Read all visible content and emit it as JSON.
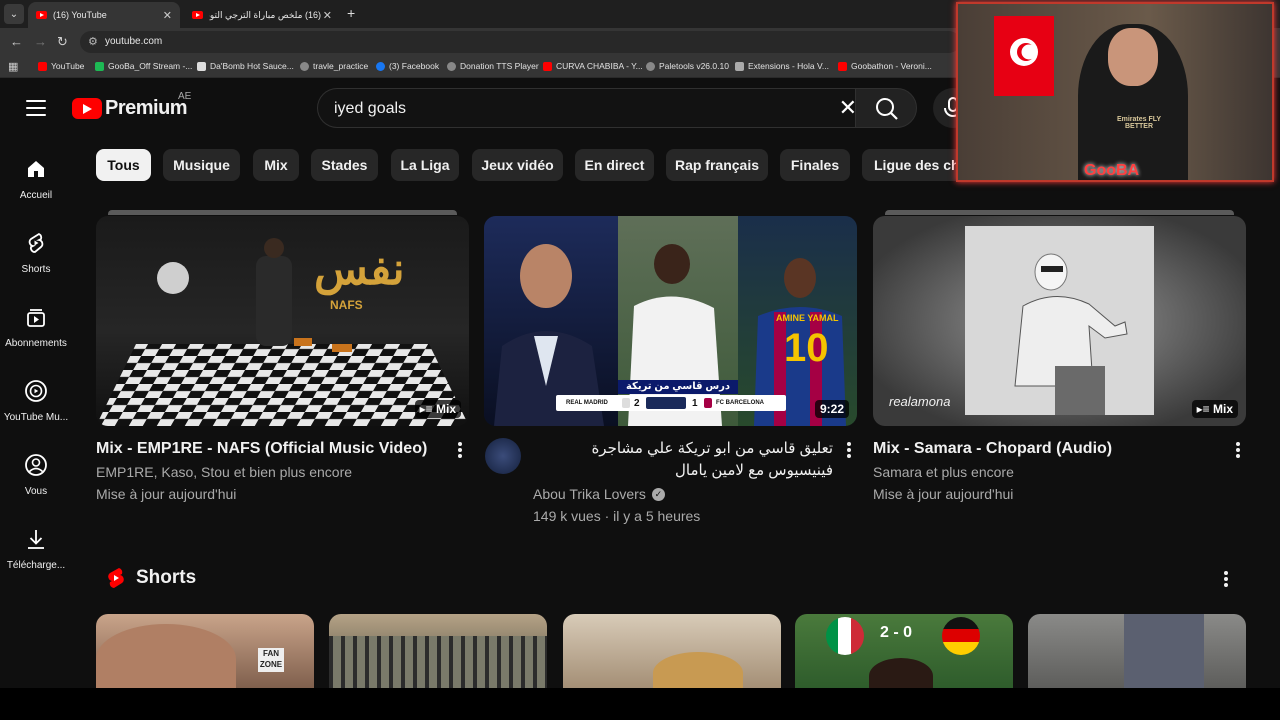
{
  "browser": {
    "tabs": [
      {
        "title": "(16) YouTube"
      },
      {
        "title": "(16) ملخص مباراة الترجي التونس..."
      }
    ],
    "url": "youtube.com",
    "bookmarks": [
      {
        "label": "YouTube",
        "color": "#ff0000"
      },
      {
        "label": "GooBa_Off Stream -...",
        "color": "#1db954"
      },
      {
        "label": "Da'Bomb Hot Sauce...",
        "color": "#dddddd"
      },
      {
        "label": "travle_practice",
        "color": "#888888"
      },
      {
        "label": "(3) Facebook",
        "color": "#1877f2"
      },
      {
        "label": "Donation TTS Player",
        "color": "#888888"
      },
      {
        "label": "CURVA CHABIBA - Y...",
        "color": "#ff0000"
      },
      {
        "label": "Paletools v26.0.10",
        "color": "#888888"
      },
      {
        "label": "Extensions - Hola V...",
        "color": "#aaaaaa"
      },
      {
        "label": "Goobathon - Veroni...",
        "color": "#ff0000"
      }
    ]
  },
  "header": {
    "brand": "Premium",
    "country": "AE",
    "search_query": "iyed goals"
  },
  "sidebar": {
    "items": [
      {
        "label": "Accueil",
        "icon": "home-icon"
      },
      {
        "label": "Shorts",
        "icon": "shorts-icon"
      },
      {
        "label": "Abonnements",
        "icon": "subscriptions-icon"
      },
      {
        "label": "YouTube Mu...",
        "icon": "youtube-music-icon"
      },
      {
        "label": "Vous",
        "icon": "user-icon"
      },
      {
        "label": "Télécharge...",
        "icon": "download-icon"
      }
    ]
  },
  "chips": [
    "Tous",
    "Musique",
    "Mix",
    "Stades",
    "La Liga",
    "Jeux vidéo",
    "En direct",
    "Rap français",
    "Finales",
    "Ligue des ch"
  ],
  "videos": [
    {
      "title": "Mix - EMP1RE - NAFS (Official Music Video)",
      "meta1": "EMP1RE, Kaso, Stou et bien plus encore",
      "meta2": "Mise à jour aujourd'hui",
      "badge": "Mix",
      "thumb_text": "NAFS",
      "thumb_arabic": "نفس"
    },
    {
      "title": "تعليق قاسي من ابو تريكة علي مشاجرة فينيسيوس مع لامين يامال",
      "channel": "Abou Trika Lovers",
      "stats": "149 k vues · il y a 5 heures",
      "badge": "9:22",
      "score_left": "REAL MADRID",
      "score_home": "2",
      "score_away": "1",
      "score_right": "FC BARCELONA",
      "banner": "درس قاسي من تريكة",
      "jersey_name": "AMINE YAMAL",
      "jersey_number": "10"
    },
    {
      "title": "Mix - Samara - Chopard (Audio)",
      "meta1": "Samara et plus encore",
      "meta2": "Mise à jour aujourd'hui",
      "badge": "Mix",
      "thumb_text": "realamona"
    }
  ],
  "shorts_section": {
    "title": "Shorts",
    "score_overlay": "2 - 0",
    "fan_zone": "FAN ZONE"
  },
  "webcam": {
    "streamer": "GooBA",
    "shirt": "Emirates FLY BETTER"
  }
}
